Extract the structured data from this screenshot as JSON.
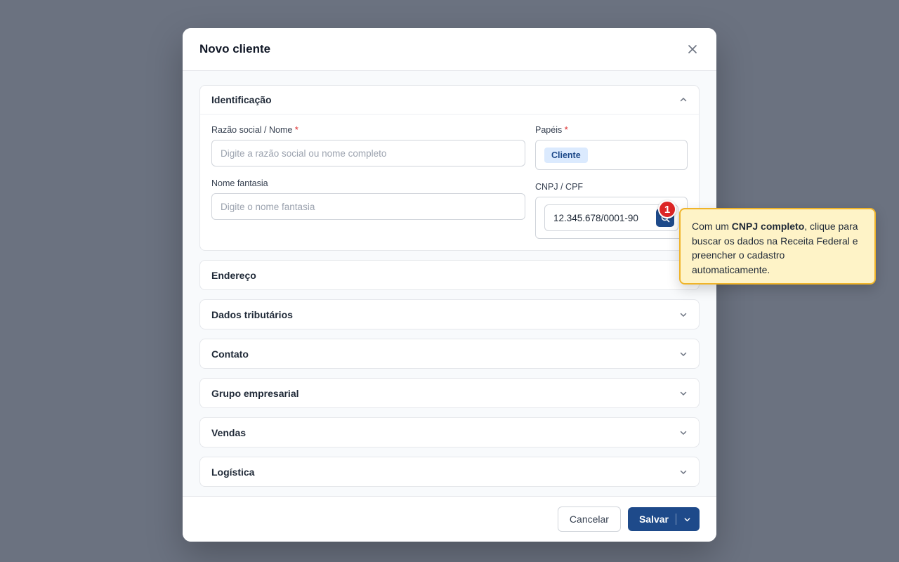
{
  "modal": {
    "title": "Novo cliente"
  },
  "identificacao": {
    "title": "Identificação",
    "razao_label": "Razão social / Nome",
    "razao_placeholder": "Digite a razão social ou nome completo",
    "papeis_label": "Papéis",
    "papeis_chip": "Cliente",
    "fantasia_label": "Nome fantasia",
    "fantasia_placeholder": "Digite o nome fantasia",
    "cnpj_label": "CNPJ / CPF",
    "cnpj_value": "12.345.678/0001-90",
    "required_mark": "*"
  },
  "sections": [
    "Endereço",
    "Dados tributários",
    "Contato",
    "Grupo empresarial",
    "Vendas",
    "Logística"
  ],
  "footer": {
    "cancel_label": "Cancelar",
    "save_label": "Salvar"
  },
  "tour": {
    "step": "1",
    "text_before": "Com um ",
    "text_bold": "CNPJ completo",
    "text_after": ", clique para buscar os dados na Receita Federal e preencher o cadastro automaticamente."
  },
  "icons": {
    "close": "close-icon",
    "chevron_up": "chevron-up-icon",
    "chevron_down": "chevron-down-icon",
    "search": "search-icon"
  },
  "colors": {
    "primary": "#1e4a8a",
    "required": "#dc2626",
    "tooltip_bg": "#fef3c7",
    "tooltip_border": "#f0b429",
    "overlay": "#6b7280"
  }
}
